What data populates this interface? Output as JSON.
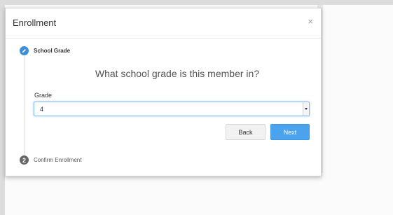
{
  "modal": {
    "title": "Enrollment",
    "close_glyph": "×"
  },
  "steps": [
    {
      "label": "School Grade",
      "icon": "pencil-icon",
      "state": "active"
    },
    {
      "label": "Confirm Enrollment",
      "number": "2",
      "state": "pending"
    }
  ],
  "form": {
    "question": "What school grade is this member in?",
    "grade_label": "Grade",
    "grade_value": "4"
  },
  "buttons": {
    "back": "Back",
    "next": "Next"
  },
  "colors": {
    "accent": "#3c8ddc",
    "next_button": "#4aa3ec",
    "step_pending": "#666666"
  }
}
